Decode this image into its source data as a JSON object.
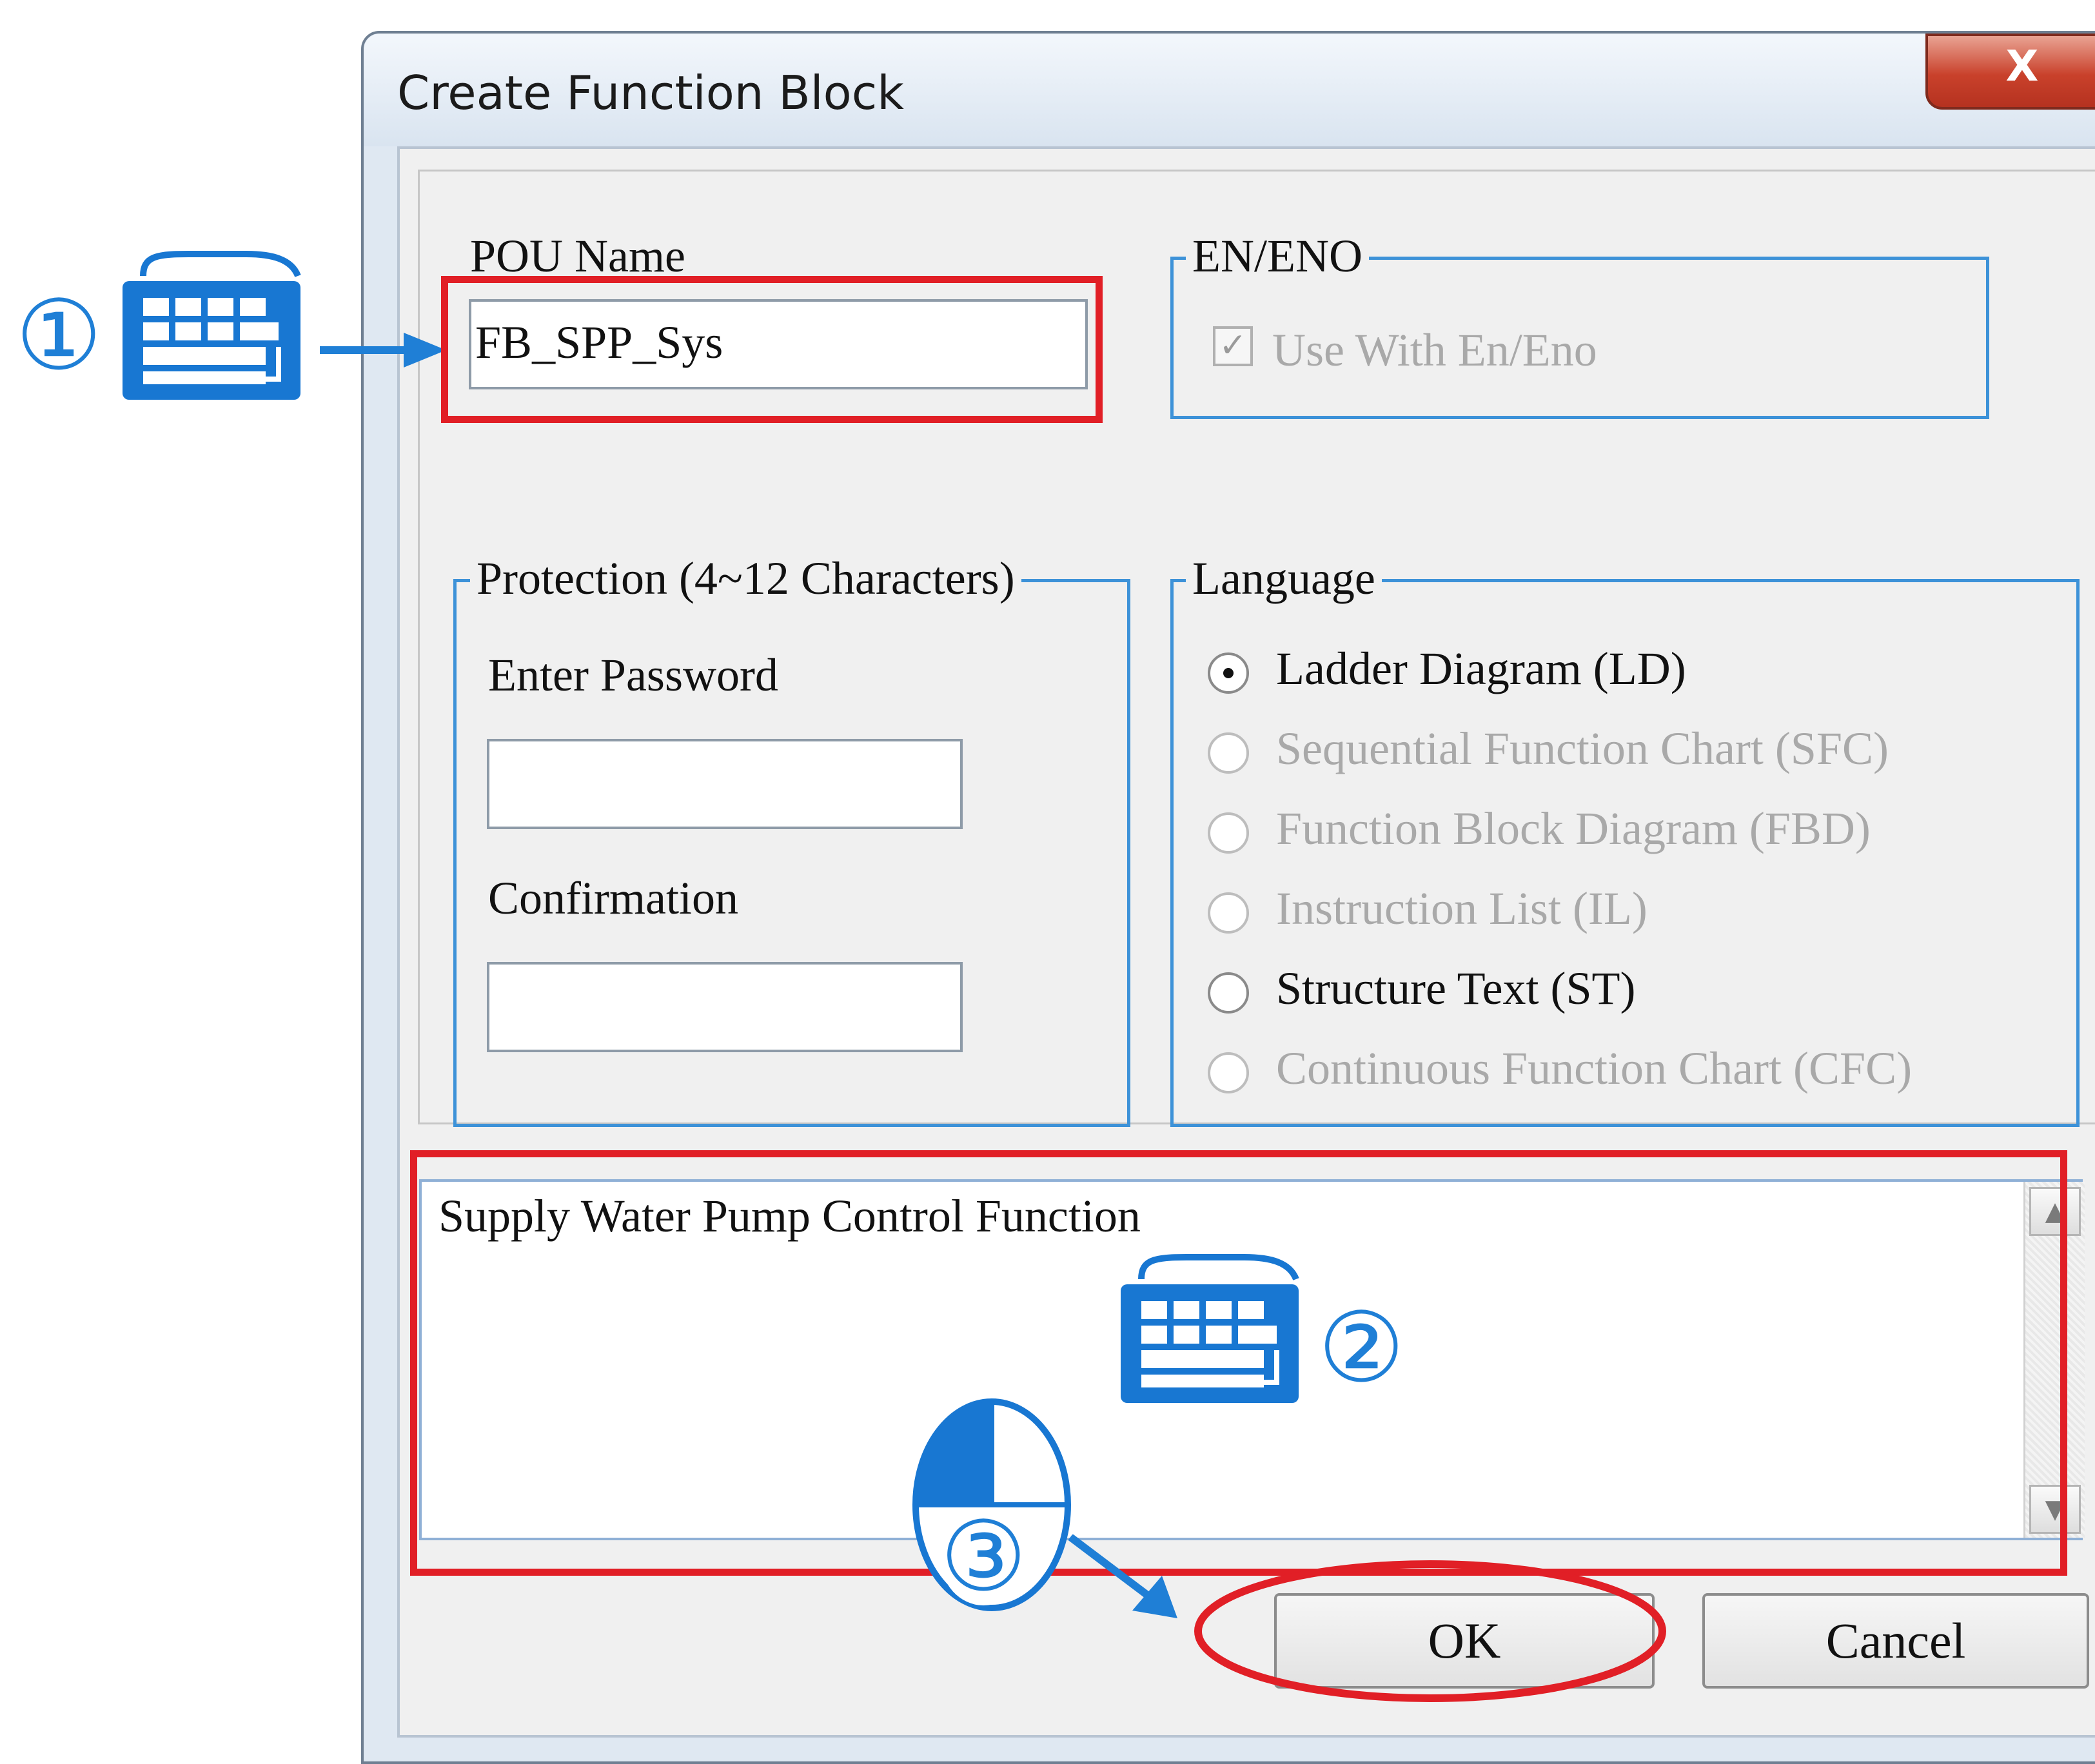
{
  "window": {
    "title": "Create Function Block",
    "close_label": "X"
  },
  "pou": {
    "label": "POU Name",
    "value": "FB_SPP_Sys"
  },
  "en_eno": {
    "legend": "EN/ENO",
    "checkbox_label": "Use With En/Eno",
    "checked": true
  },
  "protection": {
    "legend": "Protection (4~12 Characters)",
    "password_label": "Enter Password",
    "password_value": "",
    "confirm_label": "Confirmation",
    "confirm_value": ""
  },
  "language": {
    "legend": "Language",
    "options": [
      {
        "label": "Ladder Diagram (LD)",
        "selected": true,
        "enabled": true
      },
      {
        "label": "Sequential Function Chart (SFC)",
        "selected": false,
        "enabled": false
      },
      {
        "label": "Function Block Diagram (FBD)",
        "selected": false,
        "enabled": false
      },
      {
        "label": "Instruction List (IL)",
        "selected": false,
        "enabled": false
      },
      {
        "label": "Structure Text (ST)",
        "selected": false,
        "enabled": true
      },
      {
        "label": "Continuous Function Chart (CFC)",
        "selected": false,
        "enabled": false
      }
    ]
  },
  "comment": {
    "text": "Supply Water Pump Control Function"
  },
  "buttons": {
    "ok": "OK",
    "cancel": "Cancel"
  },
  "annotations": {
    "step1": "①",
    "step2": "②",
    "step3": "③",
    "accent_color": "#1f7fd6",
    "highlight_color": "#e11f26"
  }
}
